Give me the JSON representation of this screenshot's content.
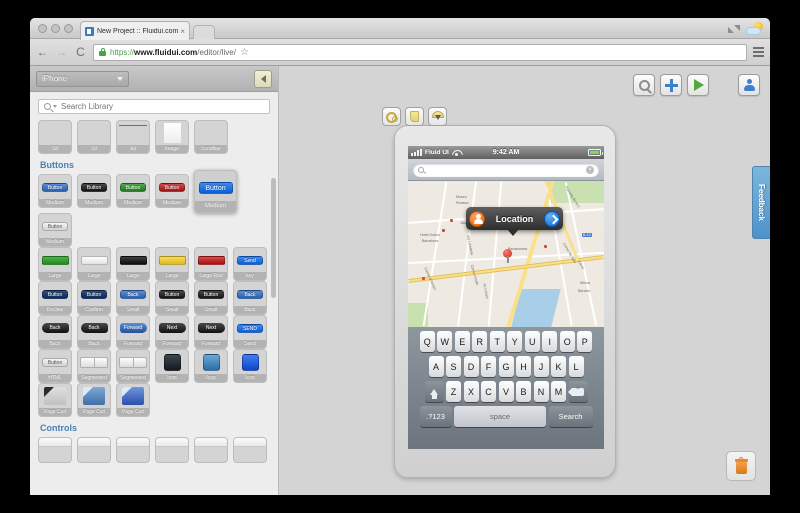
{
  "browser": {
    "tab_title": "New Project :: Fluidui.com",
    "tab_close": "×",
    "url_scheme": "https://",
    "url_host": "www.fluidui.com",
    "url_path": "/editor/live/",
    "back_label": "←",
    "forward_label": "→",
    "reload_label": "C",
    "star_label": "☆",
    "icons": [
      "traffic-close",
      "traffic-minimize",
      "traffic-zoom",
      "site-favicon",
      "lock-icon",
      "expand-icon",
      "weather-icon",
      "star-icon",
      "hamburger-icon"
    ]
  },
  "library": {
    "device_selector": "iPhone",
    "collapse_label": "‹",
    "search_placeholder": "Search Library",
    "top_items": [
      {
        "label": "Stl"
      },
      {
        "label": "Stl"
      },
      {
        "label": "Ad"
      },
      {
        "label": "Image"
      },
      {
        "label": "Scrollbar"
      }
    ],
    "sections": [
      {
        "title": "Buttons",
        "rows": [
          [
            {
              "label": "Medium",
              "art": "pill",
              "style": "blue",
              "text": "Button"
            },
            {
              "label": "Medium",
              "art": "pill",
              "style": "black",
              "text": "Button"
            },
            {
              "label": "Medium",
              "art": "pill",
              "style": "green",
              "text": "Button"
            },
            {
              "label": "Medium",
              "art": "pill",
              "style": "red",
              "text": "Button"
            },
            {
              "label": "Medium",
              "art": "pill",
              "style": "brightblue",
              "text": "Button",
              "big": true
            },
            {
              "label": "Medium",
              "art": "pill",
              "style": "grey",
              "text": "Button"
            }
          ],
          [
            {
              "label": "Large",
              "art": "bar",
              "style": "green",
              "text": ""
            },
            {
              "label": "Large",
              "art": "bar",
              "style": "white",
              "text": ""
            },
            {
              "label": "Large",
              "art": "bar",
              "style": "black",
              "text": ""
            },
            {
              "label": "Large",
              "art": "bar",
              "style": "yellow",
              "text": ""
            },
            {
              "label": "Large Red",
              "art": "bar",
              "style": "red",
              "text": ""
            },
            {
              "label": "key",
              "art": "pill",
              "style": "brightblue",
              "text": "Send"
            }
          ],
          [
            {
              "label": "Decline",
              "art": "pill",
              "style": "navy",
              "text": "Button"
            },
            {
              "label": "Confirm",
              "art": "pill",
              "style": "navy",
              "text": "Button"
            },
            {
              "label": "Small",
              "art": "pill",
              "style": "blue",
              "text": "Back"
            },
            {
              "label": "Small",
              "art": "pill",
              "style": "black",
              "text": "Button"
            },
            {
              "label": "Small",
              "art": "pill",
              "style": "black",
              "text": "Button"
            },
            {
              "label": "Back",
              "art": "pill",
              "style": "blue",
              "text": "Back"
            }
          ],
          [
            {
              "label": "Back",
              "art": "arrow-back",
              "style": "black",
              "text": "Back"
            },
            {
              "label": "Back",
              "art": "arrow-back",
              "style": "black",
              "text": "Back"
            },
            {
              "label": "Forward",
              "art": "arrow-fwd",
              "style": "blue",
              "text": "Forward"
            },
            {
              "label": "Forward",
              "art": "arrow-fwd",
              "style": "black",
              "text": "Next"
            },
            {
              "label": "Forward",
              "art": "arrow-fwd",
              "style": "black",
              "text": "Next"
            },
            {
              "label": "Send",
              "art": "pill",
              "style": "brightblue",
              "text": "SEND"
            }
          ],
          [
            {
              "label": "HTML",
              "art": "pill",
              "style": "grey",
              "text": "Button"
            },
            {
              "label": "Segmented",
              "art": "segmented",
              "style": "",
              "text": ""
            },
            {
              "label": "Segmented",
              "art": "segmented",
              "style": "",
              "text": ""
            },
            {
              "label": "Icon",
              "art": "square",
              "style": "dark",
              "text": ""
            },
            {
              "label": "Icon",
              "art": "square",
              "style": "blue",
              "text": ""
            },
            {
              "label": "Icon",
              "art": "square",
              "style": "brightblue",
              "text": ""
            }
          ],
          [
            {
              "label": "Page Curl",
              "art": "curl",
              "style": "grey",
              "text": ""
            },
            {
              "label": "Page Curl",
              "art": "curl",
              "style": "blue",
              "text": ""
            },
            {
              "label": "Page Curl",
              "art": "curl",
              "style": "blue2",
              "text": ""
            }
          ]
        ]
      },
      {
        "title": "Controls",
        "rows": [
          [
            {
              "label": "",
              "art": "control",
              "style": "",
              "text": ""
            },
            {
              "label": "",
              "art": "control",
              "style": "",
              "text": ""
            },
            {
              "label": "",
              "art": "control",
              "style": "",
              "text": ""
            },
            {
              "label": "",
              "art": "control",
              "style": "",
              "text": ""
            },
            {
              "label": "",
              "art": "control",
              "style": "",
              "text": ""
            },
            {
              "label": "",
              "art": "control",
              "style": "",
              "text": ""
            }
          ]
        ]
      }
    ]
  },
  "toolbar": {
    "buttons": [
      {
        "name": "zoom-out-button",
        "icon": "magnifier-icon"
      },
      {
        "name": "add-button",
        "icon": "plus-icon"
      },
      {
        "name": "preview-button",
        "icon": "play-icon"
      },
      {
        "name": "account-button",
        "icon": "user-icon"
      }
    ]
  },
  "device_tools": [
    {
      "name": "links-button",
      "icon": "link-icon"
    },
    {
      "name": "notes-button",
      "icon": "note-icon"
    },
    {
      "name": "gestures-button",
      "icon": "cap-icon"
    }
  ],
  "phone": {
    "status": {
      "carrier": "Fluid UI",
      "time": "9:42 AM",
      "signal_icon": "signal-bars-icon",
      "wifi_icon": "wifi-icon",
      "battery_icon": "battery-icon"
    },
    "search": {
      "placeholder": "",
      "value": "",
      "icon": "magnifier-icon",
      "clear": "×"
    },
    "map": {
      "callout_label": "Location",
      "callout_left_icon": "person-icon",
      "callout_right_icon": "disclosure-arrow-icon",
      "pin_icon": "map-pin-icon",
      "street_labels": [
        "Museu Picasso",
        "Jaume",
        "Hotel Gotico Barcelona",
        "Passeig de la C",
        "Carrer de Salvs",
        "Carrer",
        "Merca Barcelo",
        "Barceloneta",
        "Via Laietana",
        "Carrer d'Avinyo",
        "Carrer Ample",
        "de Colom",
        "B-10"
      ]
    },
    "keyboard": {
      "row1": [
        "Q",
        "W",
        "E",
        "R",
        "T",
        "Y",
        "U",
        "I",
        "O",
        "P"
      ],
      "row2": [
        "A",
        "S",
        "D",
        "F",
        "G",
        "H",
        "J",
        "K",
        "L"
      ],
      "row3": [
        "Z",
        "X",
        "C",
        "V",
        "B",
        "N",
        "M"
      ],
      "shift_icon": "shift-icon",
      "delete_icon": "backspace-icon",
      "numeric_label": ".?123",
      "space_label": "space",
      "action_label": "Search"
    }
  },
  "feedback": {
    "label": "Feedback"
  },
  "trash": {
    "icon": "trash-icon"
  }
}
